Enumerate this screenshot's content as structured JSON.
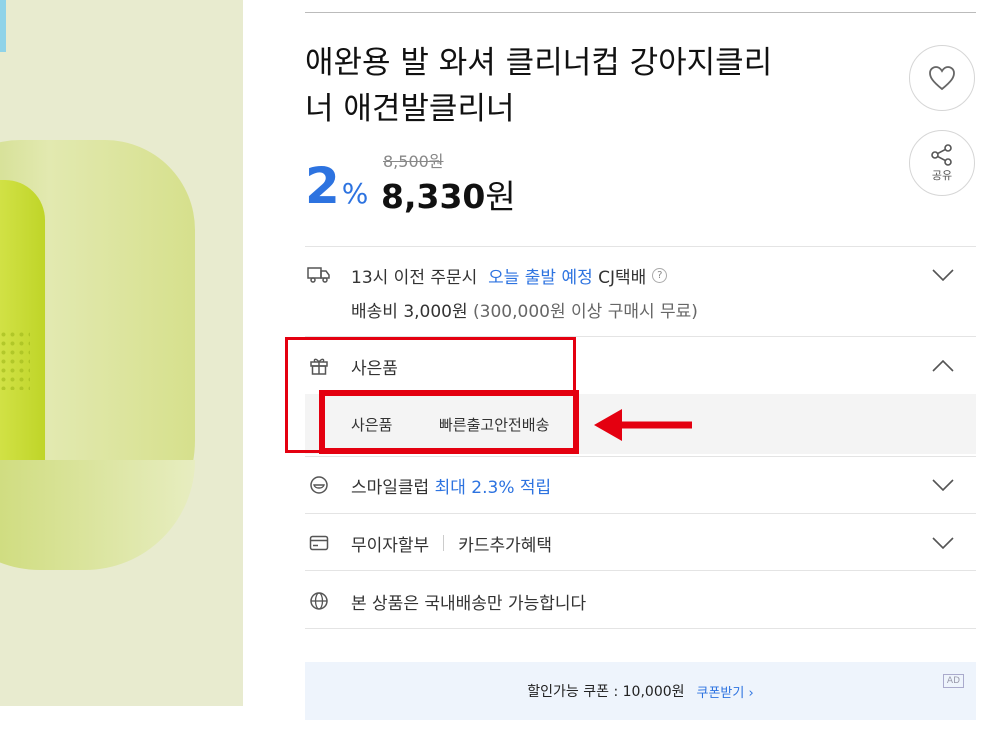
{
  "product": {
    "title_line1": "애완용 발 와셔 클리너컵 강아지클리",
    "title_line2": "너 애견발클리너",
    "discount_rate": "2",
    "discount_symbol": "%",
    "original_price": "8,500원",
    "sale_price_number": "8,330",
    "sale_price_unit": "원"
  },
  "actions": {
    "share_label": "공유"
  },
  "shipping": {
    "cutoff_text": "13시 이전 주문시",
    "dispatch_text": "오늘 출발 예정",
    "carrier": "CJ택배",
    "help_mark": "?",
    "fee_text": "배송비 3,000원",
    "free_condition": "(300,000원 이상 구매시 무료)"
  },
  "gift": {
    "header": "사은품",
    "label": "사은품",
    "value": "빠른출고안전배송"
  },
  "smile_club": {
    "label": "스마일클럽",
    "benefit": "최대 2.3% 적립"
  },
  "installment": {
    "label": "무이자할부",
    "card_benefit": "카드추가혜택"
  },
  "domestic": {
    "text": "본 상품은 국내배송만 가능합니다"
  },
  "coupon": {
    "text": "할인가능 쿠폰 : 10,000원",
    "action": "쿠폰받기 ›",
    "ad_badge": "AD"
  },
  "colors": {
    "accent_blue": "#2d73e0",
    "annotation_red": "#e40010",
    "product_green": "#c4d82a"
  },
  "icons": [
    "heart-icon",
    "share-icon",
    "truck-icon",
    "gift-icon",
    "smile-icon",
    "card-icon",
    "globe-icon",
    "chevron-down-icon",
    "chevron-up-icon"
  ]
}
